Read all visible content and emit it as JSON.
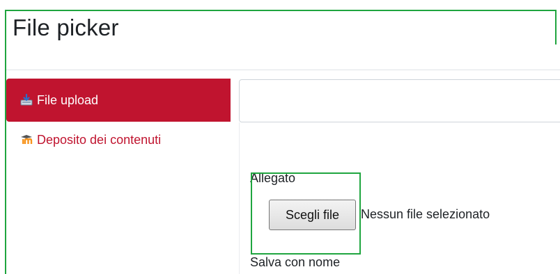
{
  "dialog": {
    "title": "File picker"
  },
  "sidebar": {
    "items": [
      {
        "label": "File upload",
        "icon": "upload-icon",
        "active": true
      },
      {
        "label": "Deposito dei contenuti",
        "icon": "moodle-icon",
        "active": false
      }
    ]
  },
  "upload_form": {
    "attachment_label": "Allegato",
    "choose_button_label": "Scegli file",
    "no_file_text": "Nessun file selezionato",
    "save_as_label": "Salva con nome"
  },
  "colors": {
    "accent": "#c0142f",
    "highlight": "#1fa53f"
  }
}
